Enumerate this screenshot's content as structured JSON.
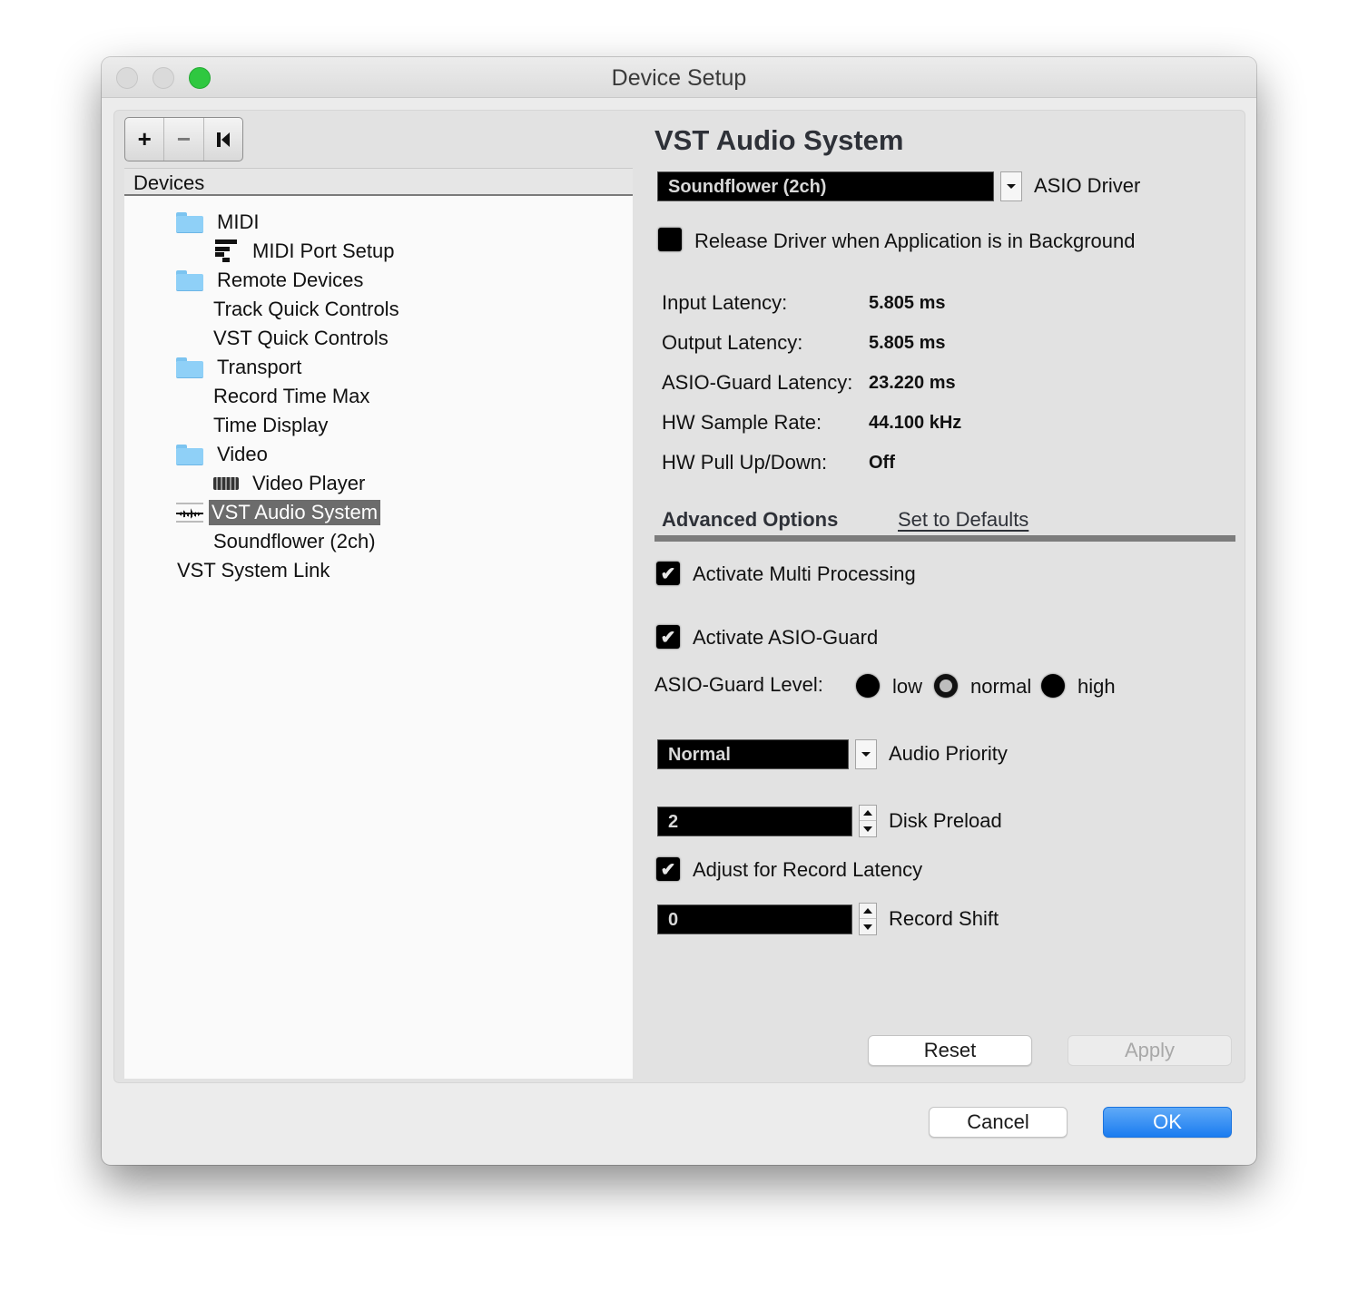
{
  "window": {
    "title": "Device Setup",
    "traffic_lights": [
      "close",
      "minimize",
      "zoom"
    ],
    "zoom_color": "#2fc840"
  },
  "toolbar": {
    "add_label": "+",
    "remove_label": "−",
    "reset_label": "⏮"
  },
  "devices_panel": {
    "header": "Devices",
    "items": [
      {
        "label": "MIDI",
        "icon": "folder-icon",
        "level": 1
      },
      {
        "label": "MIDI Port Setup",
        "icon": "midi-port-icon",
        "level": 2
      },
      {
        "label": "Remote Devices",
        "icon": "folder-icon",
        "level": 1
      },
      {
        "label": "Track Quick Controls",
        "icon": "",
        "level": 2
      },
      {
        "label": "VST Quick Controls",
        "icon": "",
        "level": 2
      },
      {
        "label": "Transport",
        "icon": "folder-icon",
        "level": 1
      },
      {
        "label": "Record Time Max",
        "icon": "",
        "level": 2
      },
      {
        "label": "Time Display",
        "icon": "",
        "level": 2
      },
      {
        "label": "Video",
        "icon": "folder-icon",
        "level": 1
      },
      {
        "label": "Video Player",
        "icon": "video-player-icon",
        "level": 2
      },
      {
        "label": "VST Audio System",
        "icon": "audio-waveform-icon",
        "level": 1,
        "selected": true
      },
      {
        "label": "Soundflower (2ch)",
        "icon": "",
        "level": 2
      },
      {
        "label": "VST System Link",
        "icon": "",
        "level": 0
      }
    ]
  },
  "main": {
    "title": "VST Audio System",
    "asio_driver": {
      "value": "Soundflower (2ch)",
      "label": "ASIO Driver"
    },
    "release_driver": {
      "label": "Release Driver when Application is in Background",
      "checked": false
    },
    "info": [
      {
        "label": "Input Latency:",
        "value": "5.805 ms"
      },
      {
        "label": "Output Latency:",
        "value": "5.805 ms"
      },
      {
        "label": "ASIO-Guard Latency:",
        "value": "23.220 ms"
      },
      {
        "label": "HW Sample Rate:",
        "value": "44.100 kHz"
      },
      {
        "label": "HW Pull Up/Down:",
        "value": "Off"
      }
    ],
    "tabs": {
      "advanced": "Advanced Options",
      "defaults": "Set to Defaults"
    },
    "multi_processing": {
      "label": "Activate Multi Processing",
      "checked": true
    },
    "asio_guard": {
      "label": "Activate ASIO-Guard",
      "checked": true
    },
    "asio_guard_level": {
      "label": "ASIO-Guard Level:",
      "options": [
        "low",
        "normal",
        "high"
      ],
      "selected": "normal"
    },
    "audio_priority": {
      "value": "Normal",
      "label": "Audio Priority"
    },
    "disk_preload": {
      "value": "2",
      "label": "Disk Preload"
    },
    "record_latency": {
      "label": "Adjust for Record Latency",
      "checked": true
    },
    "record_shift": {
      "value": "0",
      "label": "Record Shift"
    },
    "check_mark": "✔",
    "reset_label": "Reset",
    "apply_label": "Apply"
  },
  "footer": {
    "cancel_label": "Cancel",
    "ok_label": "OK",
    "ok_color": "#1b7cf0"
  }
}
